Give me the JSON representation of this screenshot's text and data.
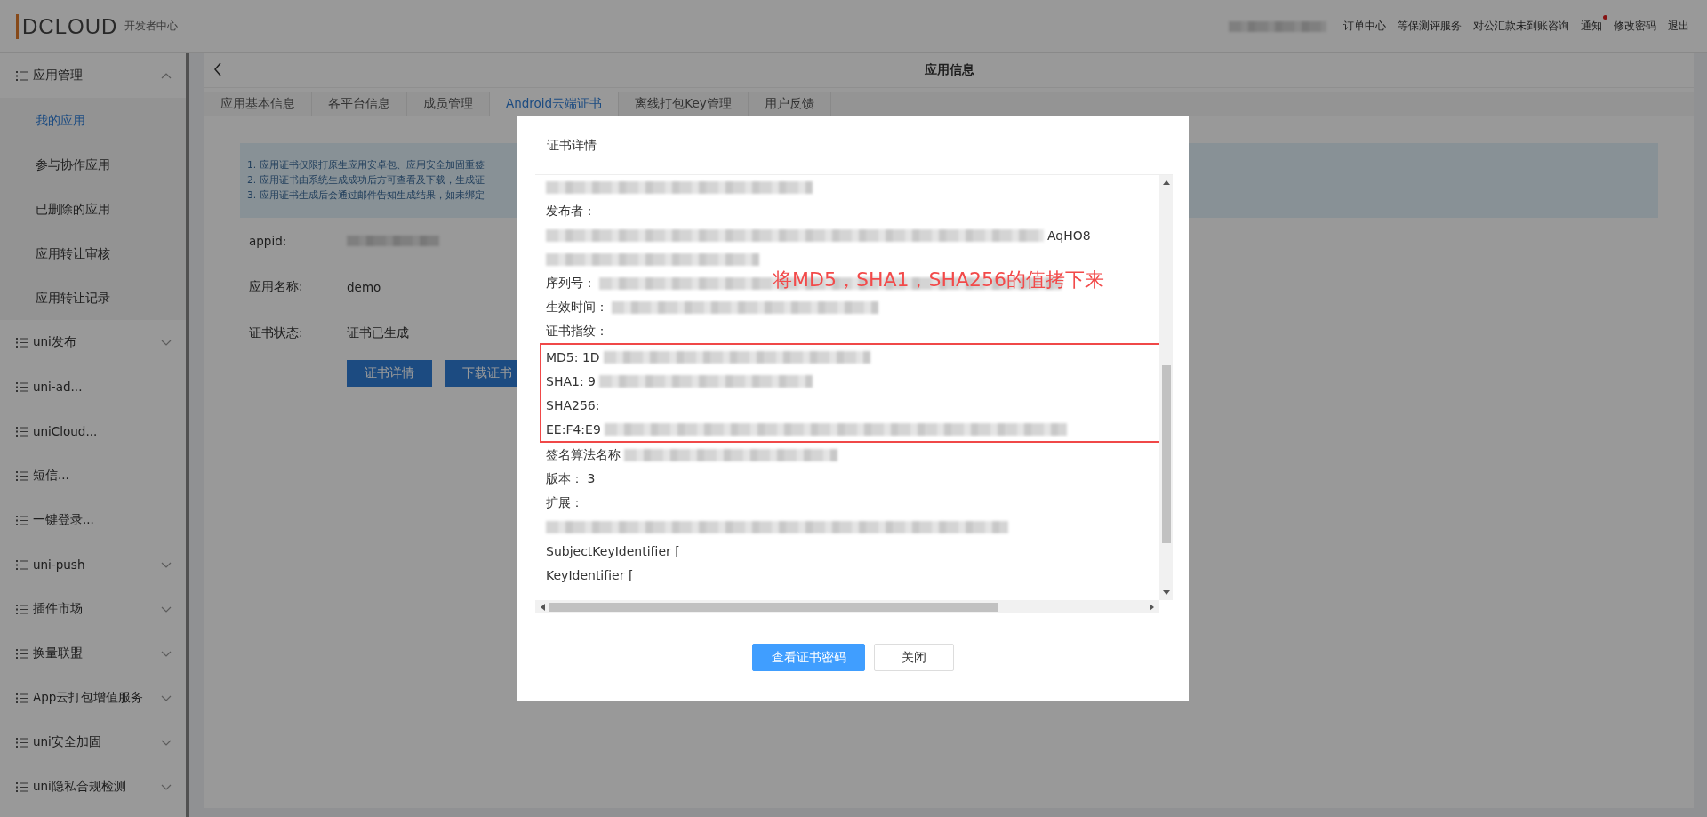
{
  "header": {
    "logo": "DCLOUD",
    "subtitle": "开发者中心",
    "links": [
      {
        "label": "订单中心",
        "dot": false
      },
      {
        "label": "等保测评服务",
        "dot": false
      },
      {
        "label": "对公汇款未到账咨询",
        "dot": false
      },
      {
        "label": "通知",
        "dot": true
      },
      {
        "label": "修改密码",
        "dot": false
      },
      {
        "label": "退出",
        "dot": false
      }
    ]
  },
  "sidebar": {
    "items": [
      {
        "label": "应用管理",
        "expandable": true,
        "expanded": true,
        "children": [
          {
            "label": "我的应用",
            "selected": true
          },
          {
            "label": "参与协作应用",
            "selected": false
          },
          {
            "label": "已删除的应用",
            "selected": false
          },
          {
            "label": "应用转让审核",
            "selected": false
          },
          {
            "label": "应用转让记录",
            "selected": false
          }
        ]
      },
      {
        "label": "uni发布",
        "expandable": true,
        "expanded": false
      },
      {
        "label": "uni-ad...",
        "expandable": false
      },
      {
        "label": "uniCloud...",
        "expandable": false
      },
      {
        "label": "短信...",
        "expandable": false
      },
      {
        "label": "一键登录...",
        "expandable": false
      },
      {
        "label": "uni-push",
        "expandable": true,
        "expanded": false
      },
      {
        "label": "插件市场",
        "expandable": true,
        "expanded": false
      },
      {
        "label": "换量联盟",
        "expandable": true,
        "expanded": false
      },
      {
        "label": "App云打包增值服务",
        "expandable": true,
        "expanded": false
      },
      {
        "label": "uni安全加固",
        "expandable": true,
        "expanded": false
      },
      {
        "label": "uni隐私合规检测",
        "expandable": true,
        "expanded": false
      }
    ]
  },
  "page": {
    "title": "应用信息",
    "tabs": [
      {
        "label": "应用基本信息",
        "selected": false
      },
      {
        "label": "各平台信息",
        "selected": false
      },
      {
        "label": "成员管理",
        "selected": false
      },
      {
        "label": "Android云端证书",
        "selected": true
      },
      {
        "label": "离线打包Key管理",
        "selected": false
      },
      {
        "label": "用户反馈",
        "selected": false
      }
    ],
    "notice": [
      "1. 应用证书仅限打原生应用安卓包、应用安全加固重签",
      "2. 应用证书由系统生成成功后方可查看及下载，生成证",
      "3. 应用证书生成后会通过邮件告知生成结果，如未绑定"
    ],
    "fields": [
      {
        "label": "appid:",
        "masked": true
      },
      {
        "label": "应用名称:",
        "value": "demo",
        "masked": false
      },
      {
        "label": "证书状态:",
        "value": "证书已生成",
        "masked": false
      }
    ],
    "buttons": [
      "证书详情",
      "下载证书"
    ]
  },
  "dialog": {
    "title": "证书详情",
    "lines_before": [
      {
        "kind": "masked"
      },
      {
        "kind": "plain",
        "text": "发布者："
      },
      {
        "kind": "masked_head",
        "text": "AqHO8"
      },
      {
        "kind": "masked"
      },
      {
        "kind": "masked_tail",
        "text": "序列号："
      },
      {
        "kind": "masked_tail",
        "text": "生效时间："
      },
      {
        "kind": "plain",
        "text": "证书指纹："
      }
    ],
    "highlighted": [
      {
        "kind": "masked_tail",
        "text": "MD5: 1D"
      },
      {
        "kind": "masked_tail",
        "text": "SHA1: 9"
      },
      {
        "kind": "plain",
        "text": "SHA256:"
      },
      {
        "kind": "masked_tail",
        "text": "EE:F4:E9"
      }
    ],
    "lines_after": [
      {
        "kind": "masked_tail",
        "text": "签名算法名称"
      },
      {
        "kind": "plain",
        "text": "版本：  3"
      },
      {
        "kind": "plain",
        "text": "扩展："
      },
      {
        "kind": "masked"
      },
      {
        "kind": "plain",
        "text": "SubjectKeyIdentifier ["
      },
      {
        "kind": "plain",
        "text": "KeyIdentifier ["
      }
    ],
    "annotation": "将MD5，SHA1，SHA256的值拷下来",
    "buttons": [
      {
        "label": "查看证书密码",
        "kind": "primary"
      },
      {
        "label": "关闭",
        "kind": "default"
      }
    ]
  }
}
